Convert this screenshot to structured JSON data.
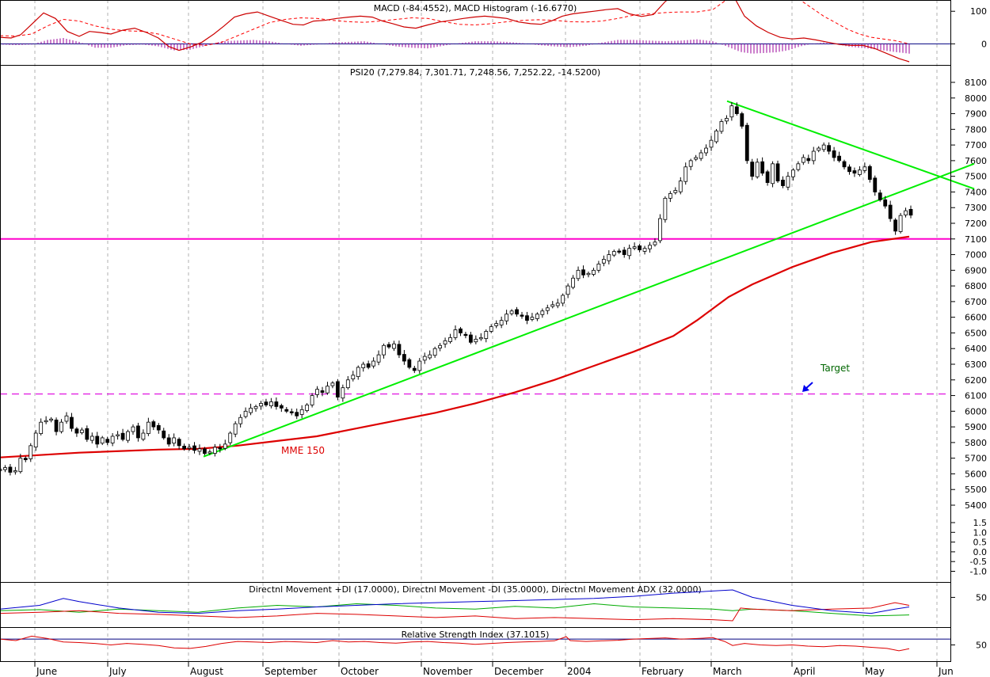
{
  "chart_data": [
    {
      "type": "line",
      "panel": "macd",
      "title": "MACD (-84.4552), MACD Histogram (-16.6770)",
      "y_ticks": [
        "100",
        "0"
      ],
      "ylim": [
        -55,
        120
      ],
      "colors": {
        "line": "#cc0000",
        "signal": "#ff0000",
        "histogram": "#990099",
        "zero": "#000080"
      },
      "series": [
        {
          "name": "MACD (-84.4552)",
          "x": [
            0,
            14,
            26,
            40,
            55,
            70,
            85,
            100,
            113,
            126,
            140,
            155,
            170,
            185,
            200,
            213,
            226,
            240,
            255,
            270,
            283,
            296,
            310,
            325,
            340,
            355,
            370,
            383,
            396,
            410,
            425,
            440,
            455,
            470,
            483,
            496,
            510,
            525,
            540,
            555,
            570,
            585,
            598,
            612,
            625,
            640,
            655,
            670,
            683,
            696,
            710,
            723,
            736,
            750,
            765,
            780,
            795,
            810,
            825,
            840,
            855,
            870,
            885,
            900,
            913,
            920,
            930,
            940,
            955,
            970,
            985,
            1000,
            1015,
            1030,
            1045,
            1060,
            1075,
            1090,
            1105,
            1120,
            1135,
            1148
          ],
          "values": [
            20,
            18,
            28,
            60,
            95,
            78,
            38,
            23,
            38,
            35,
            30,
            42,
            48,
            35,
            18,
            -8,
            -20,
            -10,
            5,
            30,
            55,
            82,
            92,
            98,
            85,
            72,
            60,
            58,
            70,
            72,
            78,
            82,
            85,
            82,
            70,
            62,
            52,
            48,
            58,
            67,
            72,
            78,
            82,
            85,
            82,
            78,
            67,
            62,
            60,
            70,
            85,
            92,
            96,
            100,
            105,
            108,
            92,
            84,
            90,
            130,
            158,
            168,
            172,
            180,
            182,
            173,
            130,
            85,
            55,
            35,
            20,
            15,
            18,
            12,
            5,
            -2,
            -5,
            -5,
            -15,
            -30,
            -45,
            -55
          ]
        },
        {
          "name": "signal",
          "x": [
            0,
            20,
            40,
            60,
            80,
            100,
            120,
            140,
            160,
            180,
            200,
            220,
            240,
            260,
            280,
            300,
            320,
            340,
            360,
            380,
            400,
            420,
            440,
            460,
            480,
            500,
            520,
            540,
            560,
            580,
            600,
            620,
            640,
            660,
            680,
            700,
            720,
            740,
            760,
            780,
            800,
            820,
            840,
            860,
            880,
            900,
            920,
            935,
            950,
            965,
            980,
            995,
            1010,
            1025,
            1040,
            1055,
            1070,
            1085,
            1100,
            1115,
            1130,
            1148
          ],
          "values": [
            25,
            24,
            30,
            55,
            75,
            70,
            55,
            45,
            40,
            38,
            30,
            15,
            0,
            -5,
            5,
            25,
            45,
            65,
            75,
            80,
            78,
            72,
            68,
            66,
            70,
            75,
            80,
            78,
            68,
            60,
            58,
            62,
            68,
            72,
            74,
            72,
            68,
            67,
            70,
            78,
            88,
            92,
            96,
            98,
            98,
            105,
            140,
            160,
            168,
            172,
            172,
            165,
            135,
            110,
            85,
            65,
            45,
            30,
            20,
            15,
            10,
            0
          ]
        },
        {
          "name": "MACD Histogram (-16.6770)",
          "x": [
            0,
            20,
            40,
            60,
            80,
            100,
            120,
            140,
            160,
            180,
            200,
            220,
            240,
            260,
            280,
            300,
            320,
            340,
            360,
            380,
            400,
            420,
            440,
            460,
            480,
            500,
            520,
            540,
            560,
            580,
            600,
            620,
            640,
            660,
            680,
            700,
            720,
            740,
            760,
            780,
            800,
            820,
            840,
            860,
            880,
            900,
            920,
            935,
            950,
            965,
            980,
            995,
            1010,
            1025,
            1040,
            1055,
            1070,
            1085,
            1100,
            1115,
            1130,
            1148
          ],
          "values": [
            -2,
            -4,
            -2,
            12,
            18,
            6,
            -12,
            -12,
            -4,
            -2,
            -8,
            -20,
            -18,
            -6,
            8,
            10,
            12,
            8,
            0,
            -6,
            -2,
            4,
            6,
            8,
            0,
            -8,
            -12,
            -14,
            -6,
            2,
            8,
            8,
            6,
            2,
            -4,
            -8,
            -10,
            -6,
            4,
            12,
            12,
            10,
            8,
            10,
            14,
            8,
            -10,
            -25,
            -30,
            -28,
            -26,
            -20,
            -8,
            0,
            4,
            0,
            -8,
            -12,
            -15,
            -20,
            -25,
            -30
          ]
        }
      ]
    },
    {
      "type": "candlestick",
      "panel": "price",
      "title": "PSI20 (7,279.84, 7,301.71, 7,248.56, 7,252.22, -14.5200)",
      "ylim": [
        5400,
        8100
      ],
      "y_ticks": [
        "8100",
        "8000",
        "7900",
        "7800",
        "7700",
        "7600",
        "7500",
        "7400",
        "7300",
        "7200",
        "7100",
        "7000",
        "6900",
        "6800",
        "6700",
        "6600",
        "6500",
        "6400",
        "6300",
        "6200",
        "6100",
        "6000",
        "5900",
        "5800",
        "5700",
        "5600",
        "5500",
        "5400"
      ],
      "lower_ticks": [
        "1.5",
        "1.0",
        "0.5",
        "0.0",
        "-0.5",
        "-1.0"
      ],
      "x_labels": [
        "June",
        "July",
        "August",
        "September",
        "October",
        "November",
        "December",
        "2004",
        "February",
        "March",
        "April",
        "May",
        "Jun"
      ],
      "colors": {
        "up": "#ffffff",
        "down": "#000000",
        "wick": "#000000",
        "mme": "#dd0000",
        "trend": "#00ee00",
        "support": "#ff00cc",
        "target": "#dd00dd",
        "arrow": "#0000ee",
        "annotation": "#006600"
      },
      "closes": [
        5630,
        5640,
        5610,
        5620,
        5700,
        5690,
        5780,
        5860,
        5930,
        5940,
        5950,
        5870,
        5930,
        5970,
        5890,
        5860,
        5880,
        5820,
        5840,
        5790,
        5830,
        5800,
        5840,
        5850,
        5820,
        5870,
        5900,
        5830,
        5860,
        5930,
        5900,
        5880,
        5830,
        5790,
        5830,
        5780,
        5760,
        5770,
        5750,
        5760,
        5730,
        5740,
        5770,
        5760,
        5790,
        5860,
        5920,
        5960,
        6000,
        6020,
        6030,
        6050,
        6040,
        6060,
        6030,
        6020,
        6000,
        5990,
        5970,
        6010,
        6040,
        6100,
        6140,
        6120,
        6160,
        6180,
        6090,
        6150,
        6200,
        6230,
        6280,
        6300,
        6280,
        6320,
        6360,
        6420,
        6410,
        6430,
        6360,
        6320,
        6280,
        6260,
        6320,
        6350,
        6360,
        6400,
        6420,
        6450,
        6470,
        6520,
        6500,
        6490,
        6440,
        6460,
        6470,
        6510,
        6540,
        6560,
        6580,
        6620,
        6640,
        6620,
        6610,
        6580,
        6600,
        6620,
        6640,
        6660,
        6680,
        6690,
        6740,
        6800,
        6850,
        6900,
        6870,
        6880,
        6900,
        6940,
        6970,
        7000,
        7020,
        7020,
        7000,
        7040,
        7050,
        7030,
        7040,
        7060,
        7080,
        7230,
        7360,
        7390,
        7410,
        7470,
        7560,
        7600,
        7620,
        7650,
        7680,
        7730,
        7790,
        7850,
        7870,
        7950,
        7900,
        7820,
        7600,
        7500,
        7590,
        7520,
        7460,
        7580,
        7470,
        7440,
        7500,
        7540,
        7580,
        7620,
        7600,
        7660,
        7680,
        7700,
        7660,
        7620,
        7600,
        7560,
        7530,
        7520,
        7540,
        7560,
        7480,
        7400,
        7350,
        7310,
        7230,
        7150,
        7250,
        7280,
        7252
      ],
      "x_start": 0,
      "x_end": 1150,
      "mme150": {
        "name": "MME 150",
        "x": [
          0,
          100,
          200,
          250,
          300,
          350,
          400,
          450,
          500,
          550,
          600,
          650,
          700,
          750,
          800,
          850,
          880,
          920,
          950,
          1000,
          1050,
          1100,
          1148
        ],
        "values": [
          5705,
          5735,
          5755,
          5760,
          5780,
          5810,
          5840,
          5890,
          5940,
          5990,
          6050,
          6120,
          6200,
          6290,
          6380,
          6480,
          6580,
          6730,
          6810,
          6920,
          7010,
          7080,
          7115
        ]
      },
      "lines": [
        {
          "name": "uptrend",
          "x": [
            257,
            1230
          ],
          "y": [
            5710,
            7580
          ]
        },
        {
          "name": "downtrend",
          "x": [
            918,
            1230
          ],
          "y": [
            7980,
            7420
          ]
        },
        {
          "name": "support",
          "y": 7100
        },
        {
          "name": "target",
          "y": 6110
        }
      ],
      "labels": {
        "mme": "MME 150",
        "target": "Target"
      }
    },
    {
      "type": "line",
      "panel": "dmi",
      "title": "Directnl Movement +DI (17.0000), Directnl Movement -DI (35.0000), Directnl Movement ADX (32.0000)",
      "ylim": [
        0,
        70
      ],
      "y_ticks": [
        "50"
      ],
      "series": [
        {
          "name": "+DI (17.0000)",
          "color": "#00aa00",
          "x": [
            0,
            50,
            100,
            150,
            200,
            250,
            300,
            350,
            400,
            450,
            500,
            550,
            600,
            650,
            700,
            750,
            800,
            850,
            900,
            925,
            950,
            1000,
            1050,
            1100,
            1148
          ],
          "values": [
            25,
            27,
            22,
            28,
            25,
            22,
            30,
            35,
            32,
            38,
            35,
            30,
            28,
            33,
            30,
            38,
            32,
            30,
            28,
            25,
            28,
            25,
            20,
            15,
            17
          ]
        },
        {
          "name": "-DI (35.0000)",
          "color": "#dd0000",
          "x": [
            0,
            50,
            100,
            150,
            200,
            250,
            300,
            350,
            400,
            450,
            500,
            550,
            600,
            650,
            700,
            750,
            800,
            850,
            900,
            925,
            935,
            950,
            1000,
            1050,
            1100,
            1130,
            1148
          ],
          "values": [
            20,
            22,
            25,
            20,
            18,
            15,
            12,
            15,
            20,
            18,
            15,
            12,
            15,
            10,
            12,
            10,
            8,
            10,
            8,
            6,
            30,
            28,
            25,
            28,
            30,
            40,
            35
          ]
        },
        {
          "name": "ADX (32.0000)",
          "color": "#0000cc",
          "x": [
            0,
            50,
            80,
            100,
            150,
            200,
            250,
            300,
            350,
            400,
            450,
            500,
            550,
            600,
            650,
            700,
            750,
            800,
            850,
            900,
            925,
            950,
            1000,
            1050,
            1100,
            1130,
            1148
          ],
          "values": [
            28,
            35,
            48,
            42,
            30,
            22,
            20,
            25,
            28,
            32,
            35,
            38,
            40,
            42,
            44,
            46,
            48,
            52,
            58,
            62,
            64,
            50,
            35,
            25,
            20,
            28,
            32
          ]
        }
      ]
    },
    {
      "type": "line",
      "panel": "rsi",
      "title": "Relative Strength Index (37.1015)",
      "ylim": [
        0,
        100
      ],
      "y_ticks": [
        "50"
      ],
      "series": [
        {
          "name": "Relative Strength Index (37.1015)",
          "color": "#dd0000",
          "x": [
            0,
            20,
            40,
            60,
            80,
            100,
            120,
            140,
            160,
            180,
            200,
            220,
            240,
            260,
            280,
            300,
            320,
            340,
            360,
            380,
            400,
            420,
            440,
            460,
            480,
            500,
            520,
            540,
            560,
            580,
            600,
            620,
            640,
            660,
            680,
            700,
            715,
            720,
            740,
            760,
            780,
            800,
            820,
            840,
            860,
            880,
            900,
            915,
            925,
            940,
            960,
            980,
            1000,
            1020,
            1040,
            1060,
            1080,
            1100,
            1120,
            1135,
            1148
          ],
          "values": [
            70,
            65,
            80,
            72,
            60,
            58,
            55,
            50,
            55,
            52,
            48,
            40,
            38,
            45,
            55,
            62,
            60,
            58,
            62,
            60,
            58,
            65,
            60,
            62,
            58,
            56,
            60,
            62,
            58,
            56,
            52,
            55,
            58,
            60,
            62,
            64,
            78,
            65,
            62,
            64,
            66,
            70,
            72,
            74,
            70,
            72,
            75,
            62,
            48,
            55,
            50,
            48,
            50,
            46,
            44,
            48,
            46,
            42,
            38,
            30,
            37
          ]
        }
      ]
    }
  ]
}
